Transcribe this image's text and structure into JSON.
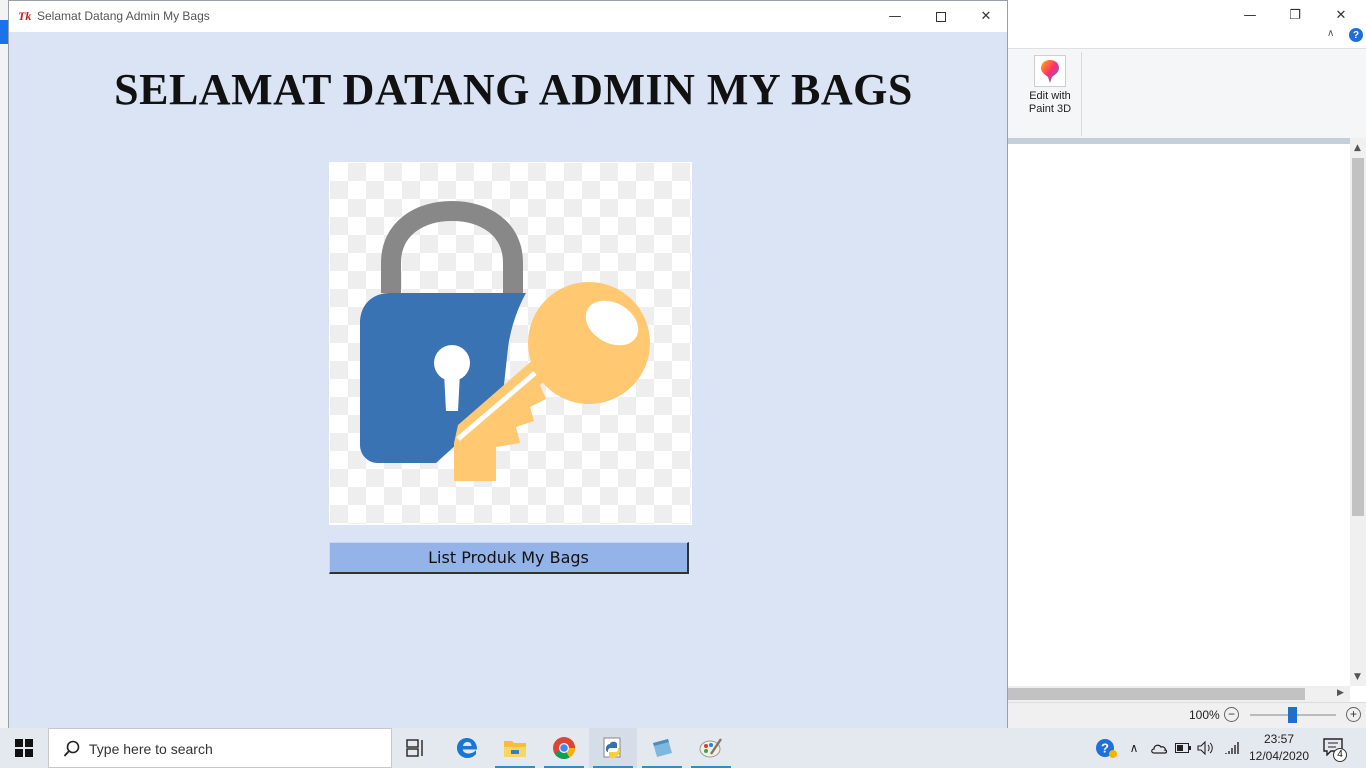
{
  "window": {
    "title": "Selamat Datang Admin My Bags",
    "logo": "Tk",
    "minimize_icon": "minimize-icon",
    "maximize_icon": "maximize-icon",
    "close_icon": "close-icon"
  },
  "main": {
    "heading": "SELAMAT DATANG ADMIN MY BAGS",
    "image_icon": "lock-and-key-icon",
    "list_button_label": "List Produk My Bags"
  },
  "background_app": {
    "ribbon_button_label_line1": "Edit with",
    "ribbon_button_label_line2": "Paint 3D",
    "help_label": "?",
    "zoom_level": "100%",
    "zoom_minus": "−",
    "zoom_plus": "+"
  },
  "taskbar": {
    "search_placeholder": "Type here to search",
    "apps": [
      "task-view",
      "edge",
      "file-explorer",
      "chrome",
      "python",
      "notepad",
      "paint"
    ],
    "clock_time": "23:57",
    "clock_date": "12/04/2020",
    "notification_count": "4"
  },
  "colors": {
    "window_bg": "#dae4f5",
    "button_bg": "#94b3e8",
    "lock_blue": "#3a73b3",
    "shackle_gray": "#888888",
    "key_orange": "#ffc871"
  }
}
